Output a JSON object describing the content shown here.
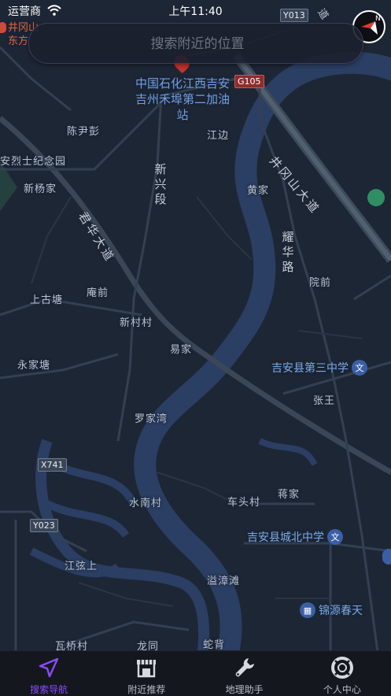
{
  "status_bar": {
    "carrier": "运营商",
    "time": "上午11:40"
  },
  "search": {
    "placeholder": "搜索附近的位置"
  },
  "map": {
    "roads": {
      "jinggangshan": "井冈山大道",
      "junhua": "君华大道",
      "xinxing": "新兴段",
      "yaohua": "耀华路"
    },
    "shields": {
      "g105": "G105",
      "x741": "X741",
      "y023": "Y023",
      "y013": "Y013"
    },
    "top_left_poi": {
      "line1": "井冈山",
      "line2": "东方"
    },
    "places": {
      "chenyinpeng": "陈尹彭",
      "jiangbian": "江边",
      "xinyangjia": "新杨家",
      "huangjia": "黄家",
      "shanggutang": "上古塘",
      "anqian": "庵前",
      "xincuncun": "新村村",
      "yuanqian": "院前",
      "yongjiatang": "永家塘",
      "yijia": "易家",
      "zhangwang": "张王",
      "luojiawan": "罗家湾",
      "shuinancun": "水南村",
      "chetoucun": "车头村",
      "jiangjia": "蒋家",
      "jiangxianshang": "江弦上",
      "yizhangtan": "溢漳滩",
      "wanqiaocun": "瓦桥村",
      "longtong": "龙同",
      "sheb": "蛇背",
      "dao": "道",
      "lieshi": "安烈士纪念园"
    },
    "pois": {
      "gas_station": "中国石化江西吉安吉州禾埠第二加油站",
      "school3": "吉安县第三中学",
      "chengbei": "吉安县城北中学",
      "jinyuan": "锦源春天"
    }
  },
  "tabs": [
    {
      "label": "搜索导航",
      "icon": "navigation-arrow-icon",
      "active": true
    },
    {
      "label": "附近推荐",
      "icon": "shop-icon",
      "active": false
    },
    {
      "label": "地理助手",
      "icon": "wrench-icon",
      "active": false
    },
    {
      "label": "个人中心",
      "icon": "lifebuoy-icon",
      "active": false
    }
  ],
  "colors": {
    "accent": "#8a4cf5",
    "map_bg": "#1d2635",
    "river": "#2d4065"
  }
}
